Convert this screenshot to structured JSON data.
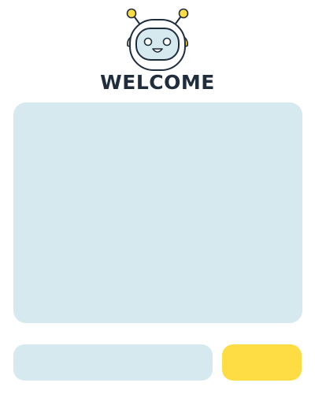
{
  "header": {
    "logo_icon": "robot-mascot-icon",
    "title": "WELCOME"
  },
  "chat": {
    "messages": []
  },
  "composer": {
    "input_value": "",
    "input_placeholder": "",
    "send_label": ""
  },
  "colors": {
    "panel": "#d5e9ef",
    "accent": "#fddc44",
    "title": "#1f2d3d",
    "background": "#ffffff"
  }
}
